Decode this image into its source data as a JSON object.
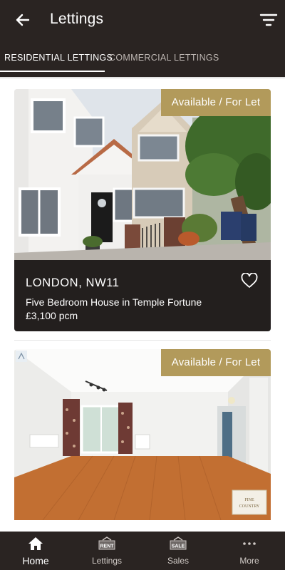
{
  "header": {
    "title": "Lettings",
    "back_icon": "arrow-left-icon",
    "filter_icon": "filter-icon"
  },
  "tabs": [
    {
      "label": "RESIDENTIAL LETTINGS",
      "active": true
    },
    {
      "label": "COMMERCIAL LETTINGS",
      "active": false
    }
  ],
  "listings": [
    {
      "status": "Available / For Let",
      "location": "LONDON, NW11",
      "description": "Five Bedroom House in Temple Fortune",
      "price": "£3,100 pcm",
      "favorite_icon": "heart-outline-icon"
    },
    {
      "status": "Available / For Let",
      "photo_watermark_line1": "FINE",
      "photo_watermark_line2": "COUNTRY"
    }
  ],
  "bottom_nav": [
    {
      "label": "Home",
      "icon": "home-icon",
      "active": true
    },
    {
      "label": "Lettings",
      "icon": "rent-sign-icon",
      "icon_text": "RENT"
    },
    {
      "label": "Sales",
      "icon": "sale-sign-icon",
      "icon_text": "SALE"
    },
    {
      "label": "More",
      "icon": "more-dots-icon"
    }
  ],
  "colors": {
    "header_bg": "#2a2422",
    "card_info_bg": "#231f1e",
    "badge_gold": "#b29a5b",
    "tab_active": "#ffffff",
    "tab_inactive": "#bdb6b2"
  }
}
